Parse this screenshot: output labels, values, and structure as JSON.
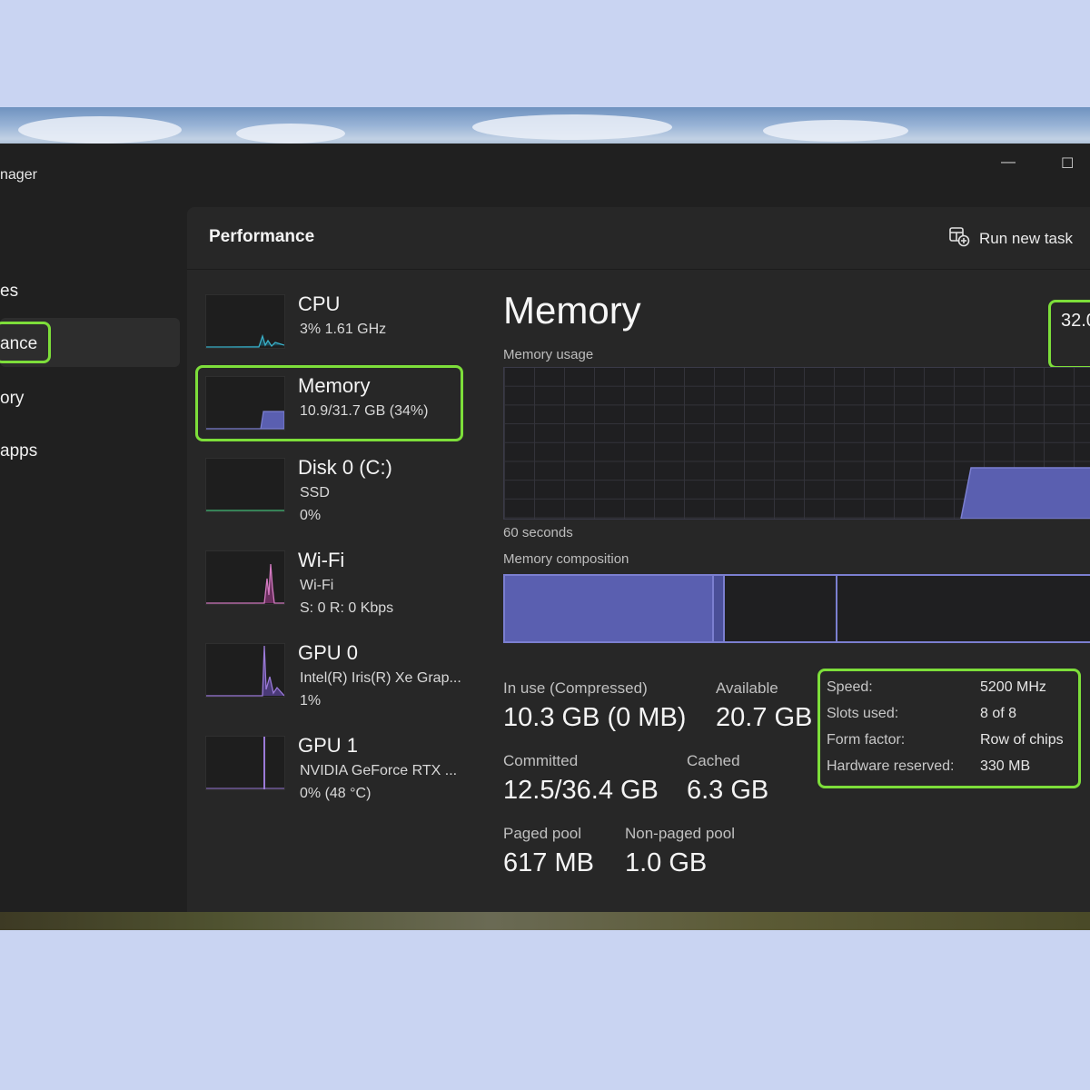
{
  "window": {
    "title": "nager",
    "minimize_glyph": "—",
    "maximize_glyph": "☐"
  },
  "nav": {
    "items": [
      {
        "label": "es"
      },
      {
        "label": "ance"
      },
      {
        "label": "ory"
      },
      {
        "label": "apps"
      }
    ]
  },
  "header": {
    "title": "Performance",
    "run_task_label": "Run new task",
    "run_task_icon": "run-task-icon"
  },
  "devices": [
    {
      "name": "CPU",
      "sub1": "3%  1.61 GHz",
      "sub2": "",
      "color": "#3ab0c8"
    },
    {
      "name": "Memory",
      "sub1": "10.9/31.7 GB (34%)",
      "sub2": "",
      "color": "#6f74cf"
    },
    {
      "name": "Disk 0 (C:)",
      "sub1": "SSD",
      "sub2": "0%",
      "color": "#3fa46a"
    },
    {
      "name": "Wi-Fi",
      "sub1": "Wi-Fi",
      "sub2": "S: 0  R: 0 Kbps",
      "color": "#d27ac0"
    },
    {
      "name": "GPU 0",
      "sub1": "Intel(R) Iris(R) Xe Grap...",
      "sub2": "1%",
      "color": "#9b7ad8"
    },
    {
      "name": "GPU 1",
      "sub1": "NVIDIA GeForce RTX ...",
      "sub2": "0%  (48 °C)",
      "color": "#9b7ad8"
    }
  ],
  "memory": {
    "title": "Memory",
    "total_capacity": "32.0",
    "usage_label": "Memory usage",
    "graph_span_label": "60 seconds",
    "composition_label": "Memory composition",
    "bar_fill_color": "#5a5fb0",
    "stats": {
      "in_use_label": "In use (Compressed)",
      "in_use_value": "10.3 GB (0 MB)",
      "available_label": "Available",
      "available_value": "20.7 GB",
      "committed_label": "Committed",
      "committed_value": "12.5/36.4 GB",
      "cached_label": "Cached",
      "cached_value": "6.3 GB",
      "paged_label": "Paged pool",
      "paged_value": "617 MB",
      "nonpaged_label": "Non-paged pool",
      "nonpaged_value": "1.0 GB"
    },
    "specs": [
      {
        "label": "Speed:",
        "value": "5200 MHz"
      },
      {
        "label": "Slots used:",
        "value": "8 of 8"
      },
      {
        "label": "Form factor:",
        "value": "Row of chips"
      },
      {
        "label": "Hardware reserved:",
        "value": "330 MB"
      }
    ]
  },
  "highlight_color": "#7dde3a"
}
